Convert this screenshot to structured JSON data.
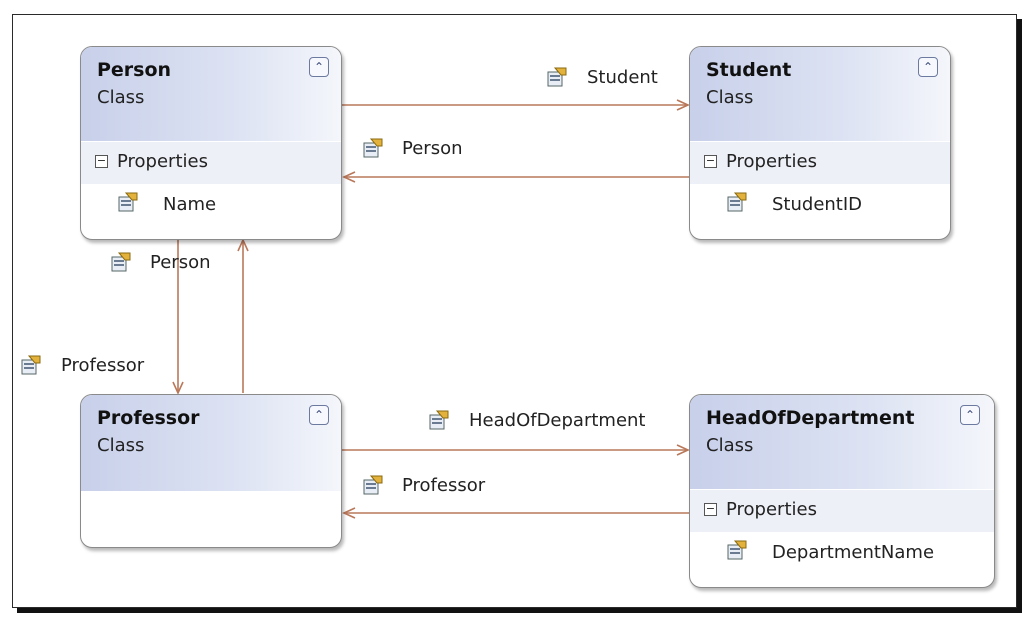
{
  "classes": {
    "person": {
      "name": "Person",
      "kind": "Class",
      "section": "Properties",
      "properties": [
        "Name"
      ]
    },
    "student": {
      "name": "Student",
      "kind": "Class",
      "section": "Properties",
      "properties": [
        "StudentID"
      ]
    },
    "professor": {
      "name": "Professor",
      "kind": "Class"
    },
    "head": {
      "name": "HeadOfDepartment",
      "kind": "Class",
      "section": "Properties",
      "properties": [
        "DepartmentName"
      ]
    }
  },
  "associations": [
    {
      "from": "Person",
      "to": "Student",
      "label": "Student"
    },
    {
      "from": "Student",
      "to": "Person",
      "label": "Person"
    },
    {
      "from": "Person",
      "to": "Professor",
      "label": "Person"
    },
    {
      "from": "Professor",
      "to": "Person",
      "label": "Professor"
    },
    {
      "from": "Professor",
      "to": "HeadOfDepartment",
      "label": "HeadOfDepartment"
    },
    {
      "from": "HeadOfDepartment",
      "to": "Professor",
      "label": "Professor"
    }
  ],
  "icons": {
    "property": "property-icon",
    "collapse": "chevron-up-icon",
    "section_toggle": "minus-box-icon"
  },
  "colors": {
    "connector": "#b9785a",
    "header": "#c8d0ea",
    "section": "#eef0f8"
  }
}
